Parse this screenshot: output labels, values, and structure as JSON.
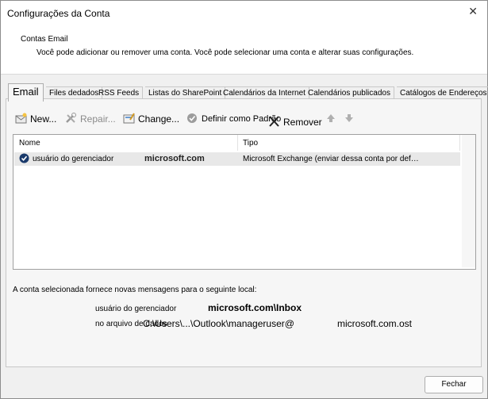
{
  "window": {
    "title": "Configurações da Conta",
    "close_glyph": "✕"
  },
  "header": {
    "section_title": "Contas Email",
    "description": "Você pode adicionar ou remover uma conta. Você pode selecionar uma conta e alterar suas configurações."
  },
  "tabs": [
    {
      "label": "Email",
      "active": true
    },
    {
      "label": "Files dedados"
    },
    {
      "label": "RSS Feeds"
    },
    {
      "label": "Listas do SharePoint"
    },
    {
      "label": "Calendários da Internet"
    },
    {
      "label": "Calendários publicados"
    },
    {
      "label": "Catálogos de Endereços"
    }
  ],
  "toolbar": {
    "new_label": "New...",
    "repair_label": "Repair...",
    "change_label": "Change...",
    "set_default_label": "Definir como Padrão",
    "remove_label": "Remover",
    "icons": {
      "new": "new-mail-icon",
      "repair": "tools-icon",
      "change": "change-icon",
      "default": "checkmark-circle-icon",
      "remove": "x-icon",
      "up": "arrow-up-icon",
      "down": "arrow-down-icon"
    }
  },
  "accounts_table": {
    "columns": [
      "Nome",
      "Tipo"
    ],
    "rows": [
      {
        "name": "usuário do gerenciador",
        "domain": "microsoft.com",
        "type": "Microsoft Exchange (enviar dessa conta por def…",
        "selected": true
      }
    ]
  },
  "delivery": {
    "label": "A conta selecionada fornece novas mensagens para o seguinte local:",
    "mailbox_name": "usuário do gerenciador",
    "inbox_path": "microsoft.com\\Inbox",
    "file_label": "no arquivo de dados",
    "file_path": "C:\\Users\\...\\Outlook\\manageruser@",
    "file_domain": "microsoft.com.ost"
  },
  "footer": {
    "close_label": "Fechar"
  },
  "colors": {
    "selection": "#e8e8e8",
    "border": "#a0a0a0",
    "accent": "#1a3a6b"
  }
}
